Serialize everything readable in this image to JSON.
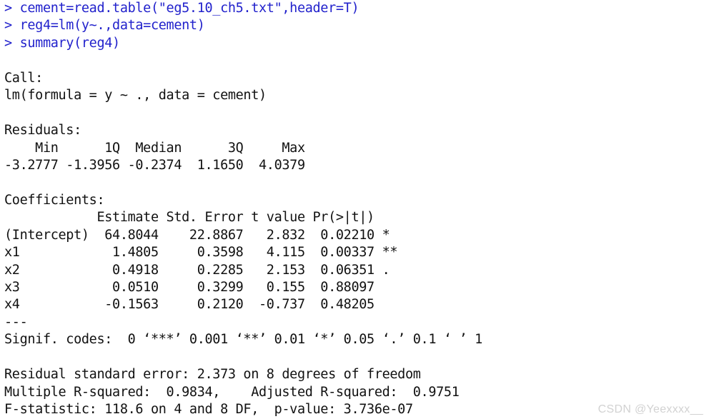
{
  "console": {
    "prompt_symbol": ">",
    "colors": {
      "background": "#ffffff",
      "command_text": "#2222cc",
      "output_text": "#111111",
      "watermark": "#d2d2d2"
    },
    "commands": [
      "> cement=read.table(\"eg5.10_ch5.txt\",header=T)",
      "> reg4=lm(y~.,data=cement)",
      "> summary(reg4)"
    ],
    "lines": [
      {
        "type": "cmd",
        "text": "> cement=read.table(\"eg5.10_ch5.txt\",header=T)"
      },
      {
        "type": "cmd",
        "text": "> reg4=lm(y~.,data=cement)"
      },
      {
        "type": "cmd",
        "text": "> summary(reg4)"
      },
      {
        "type": "blank",
        "text": ""
      },
      {
        "type": "output",
        "text": "Call:"
      },
      {
        "type": "output",
        "text": "lm(formula = y ~ ., data = cement)"
      },
      {
        "type": "blank",
        "text": ""
      },
      {
        "type": "output",
        "text": "Residuals:"
      },
      {
        "type": "output",
        "text": "    Min      1Q  Median      3Q     Max"
      },
      {
        "type": "output",
        "text": "-3.2777 -1.3956 -0.2374  1.1650  4.0379"
      },
      {
        "type": "blank",
        "text": ""
      },
      {
        "type": "output",
        "text": "Coefficients:"
      },
      {
        "type": "output",
        "text": "            Estimate Std. Error t value Pr(>|t|)"
      },
      {
        "type": "output",
        "text": "(Intercept)  64.8044    22.8867   2.832  0.02210 *"
      },
      {
        "type": "output",
        "text": "x1            1.4805     0.3598   4.115  0.00337 **"
      },
      {
        "type": "output",
        "text": "x2            0.4918     0.2285   2.153  0.06351 ."
      },
      {
        "type": "output",
        "text": "x3            0.0510     0.3299   0.155  0.88097"
      },
      {
        "type": "output",
        "text": "x4           -0.1563     0.2120  -0.737  0.48205"
      },
      {
        "type": "output",
        "text": "---"
      },
      {
        "type": "output",
        "text": "Signif. codes:  0 ‘***’ 0.001 ‘**’ 0.01 ‘*’ 0.05 ‘.’ 0.1 ‘ ’ 1"
      },
      {
        "type": "blank",
        "text": ""
      },
      {
        "type": "output",
        "text": "Residual standard error: 2.373 on 8 degrees of freedom"
      },
      {
        "type": "output",
        "text": "Multiple R-squared:  0.9834,    Adjusted R-squared:  0.9751"
      },
      {
        "type": "output",
        "text": "F-statistic: 118.6 on 4 and 8 DF,  p-value: 3.736e-07"
      }
    ],
    "call": {
      "label": "Call:",
      "formula": "lm(formula = y ~ ., data = cement)"
    },
    "residuals": {
      "label": "Residuals:",
      "headers": [
        "Min",
        "1Q",
        "Median",
        "3Q",
        "Max"
      ],
      "values": [
        -3.2777,
        -1.3956,
        -0.2374,
        1.165,
        4.0379
      ]
    },
    "coefficients": {
      "label": "Coefficients:",
      "headers": [
        "",
        "Estimate",
        "Std. Error",
        "t value",
        "Pr(>|t|)",
        ""
      ],
      "rows": [
        {
          "term": "(Intercept)",
          "estimate": "64.8044",
          "std_error": "22.8867",
          "t_value": "2.832",
          "p_value": "0.02210",
          "signif": "*"
        },
        {
          "term": "x1",
          "estimate": "1.4805",
          "std_error": "0.3598",
          "t_value": "4.115",
          "p_value": "0.00337",
          "signif": "**"
        },
        {
          "term": "x2",
          "estimate": "0.4918",
          "std_error": "0.2285",
          "t_value": "2.153",
          "p_value": "0.06351",
          "signif": "."
        },
        {
          "term": "x3",
          "estimate": "0.0510",
          "std_error": "0.3299",
          "t_value": "0.155",
          "p_value": "0.88097",
          "signif": ""
        },
        {
          "term": "x4",
          "estimate": "-0.1563",
          "std_error": "0.2120",
          "t_value": "-0.737",
          "p_value": "0.48205",
          "signif": ""
        }
      ],
      "separator": "---",
      "signif_codes": "Signif. codes:  0 ‘***’ 0.001 ‘**’ 0.01 ‘*’ 0.05 ‘.’ 0.1 ‘ ’ 1"
    },
    "statistics": {
      "residual_standard_error": "2.373",
      "residual_df": "8",
      "residual_line": "Residual standard error: 2.373 on 8 degrees of freedom",
      "multiple_r_squared": "0.9834",
      "adjusted_r_squared": "0.9751",
      "r_squared_line": "Multiple R-squared:  0.9834,    Adjusted R-squared:  0.9751",
      "f_statistic": "118.6",
      "f_df1": "4",
      "f_df2": "8",
      "f_p_value": "3.736e-07",
      "f_line": "F-statistic: 118.6 on 4 and 8 DF,  p-value: 3.736e-07"
    }
  },
  "watermark": {
    "text": "CSDN @Yeexxxx__"
  }
}
